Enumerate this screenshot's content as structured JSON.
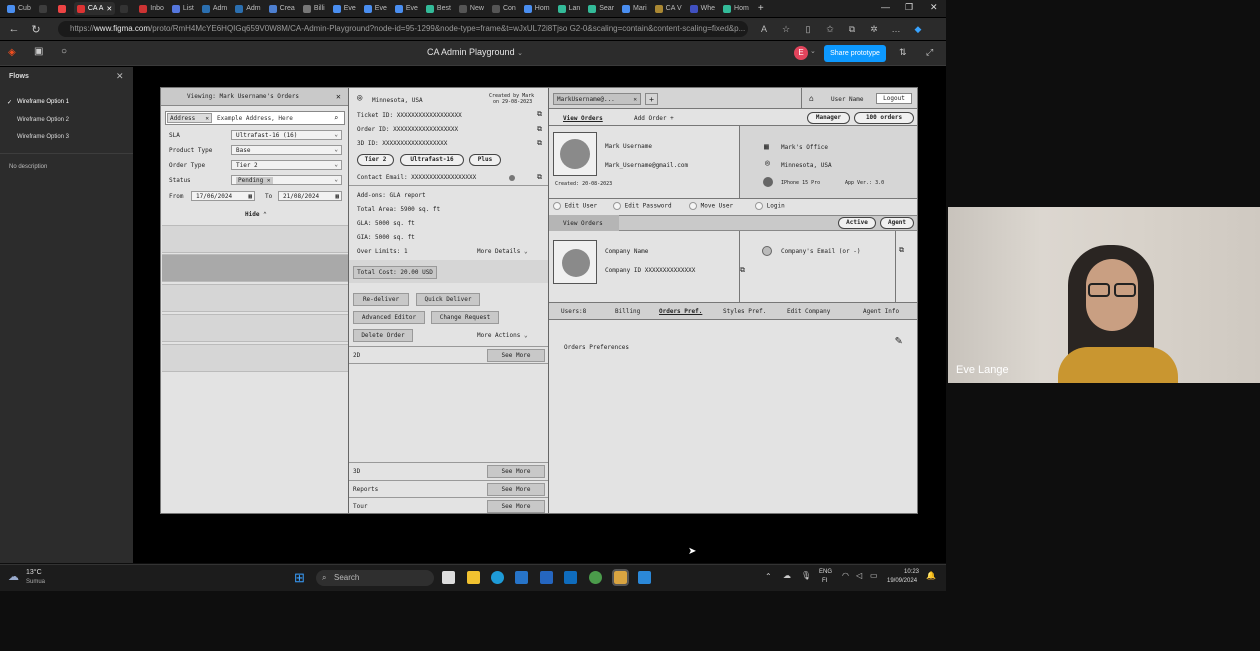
{
  "browser": {
    "tabs": [
      "Cub",
      "",
      "",
      "CA A",
      "",
      "Inbo",
      "List",
      "Adm",
      "Adm",
      "Crea",
      "Billi",
      "Eve",
      "Eve",
      "Eve",
      "Best",
      "New",
      "Con",
      "Hom",
      "Lan",
      "Sear",
      "Mari",
      "CA V",
      "Whe",
      "Hom"
    ],
    "url_prefix": "https://",
    "url_domain": "www.figma.com",
    "url_rest": "/proto/RmH4McYE6HQIGq659V0W8M/CA-Admin-Playground?node-id=95-1299&node-type=frame&t=wJxUL72i8Tjso G2-0&scaling=contain&content-scaling=fixed&p..."
  },
  "figma": {
    "file_title": "CA Admin Playground",
    "avatar_letter": "E",
    "share_label": "Share prototype"
  },
  "flows": {
    "header": "Flows",
    "items": [
      "Wireframe Option 1",
      "Wireframe Option 2",
      "Wireframe Option 3"
    ],
    "description": "No description"
  },
  "wf": {
    "left": {
      "title": "Viewing: Mark Username's Orders",
      "search_field": "Address",
      "search_placeholder": "Example Address, Here",
      "filters": [
        {
          "label": "SLA",
          "value": "Ultrafast-16 (16)"
        },
        {
          "label": "Product Type",
          "value": "Base"
        },
        {
          "label": "Order Type",
          "value": "Tier 2"
        },
        {
          "label": "Status",
          "value": "Pending"
        }
      ],
      "from_label": "From",
      "from_date": "17/06/2024",
      "to_label": "To",
      "to_date": "21/08/2024",
      "hide": "Hide"
    },
    "mid": {
      "location": "Minnesota, USA",
      "created_by": "Created by Mark",
      "created_on": "on 29-08-2023",
      "ticket": "Ticket ID: XXXXXXXXXXXXXXXXXX",
      "order": "Order ID:  XXXXXXXXXXXXXXXXXX",
      "threed": "3D ID:     XXXXXXXXXXXXXXXXXX",
      "pills": [
        "Tier 2",
        "Ultrafast-16",
        "Plus"
      ],
      "contact": "Contact Email: XXXXXXXXXXXXXXXXXX",
      "addons": "Add-ons:   GLA report",
      "area": "Total Area:  5900 sq. ft",
      "gla": "GLA:         5000 sq. ft",
      "gia": "GIA:         5000 sq. ft",
      "overlimits": "Over Limits: 1",
      "more_details": "More Details",
      "total_cost": "Total Cost: 20.00 USD",
      "actions": [
        "Re-deliver",
        "Quick Deliver",
        "Advanced Editor",
        "Change Request",
        "Delete Order"
      ],
      "more_actions": "More Actions",
      "sections": [
        {
          "label": "2D",
          "more": "See More"
        },
        {
          "label": "3D",
          "more": "See More"
        },
        {
          "label": "Reports",
          "more": "See More"
        },
        {
          "label": "Tour",
          "more": "See More"
        }
      ]
    },
    "right": {
      "user_tab": "MarkUsername@...",
      "user_name": "User Name",
      "logout": "Logout",
      "view_orders": "View Orders",
      "add_order": "Add Order",
      "manager": "Manager",
      "orders_count": "100 orders",
      "name": "Mark Username",
      "email": "Mark_Username@gmail.com",
      "created": "Created: 20-08-2023",
      "office": "Mark's Office",
      "location": "Minnesota, USA",
      "device": "IPhone 15 Pro",
      "app": "App Ver.: 3.0",
      "user_actions": [
        "Edit User",
        "Edit Password",
        "Move User",
        "Login"
      ],
      "view_orders2": "View Orders",
      "active": "Active",
      "agent": "Agent",
      "company": "Company Name",
      "company_id": "Company ID XXXXXXXXXXXXXX",
      "company_email": "Company's Email (or -)",
      "tabs": [
        "Users:8",
        "Billing",
        "Orders Pref.",
        "Styles Pref.",
        "Edit Company",
        "Agent Info"
      ],
      "prefs": "Orders Preferences"
    }
  },
  "webcam": {
    "name": "Eve Lange"
  },
  "taskbar": {
    "temp": "13°C",
    "weather": "Sumua",
    "search": "Search",
    "lang1": "ENG",
    "lang2": "FI",
    "time": "10:23",
    "date": "19/09/2024"
  },
  "colors": {
    "accent": "#0d99ff",
    "avatar": "#e2445c"
  }
}
